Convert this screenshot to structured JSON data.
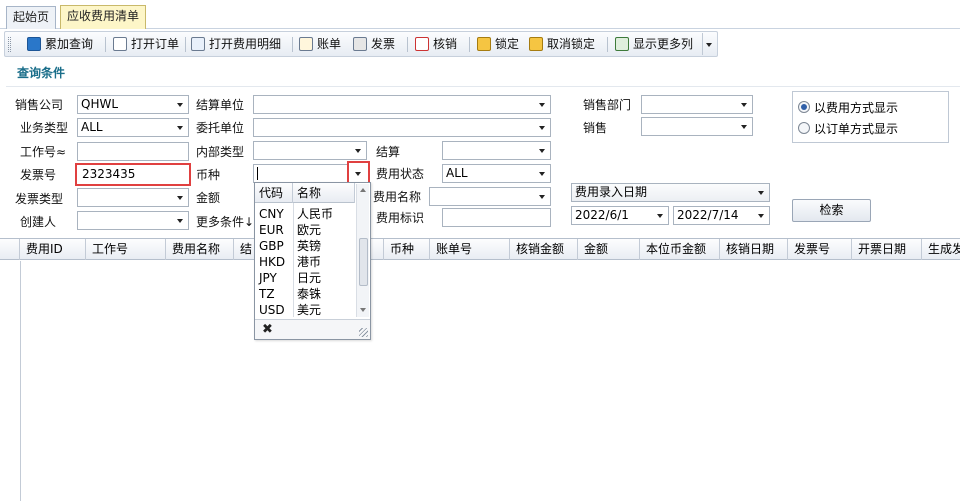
{
  "tabs": [
    {
      "label": "起始页",
      "active": false
    },
    {
      "label": "应收费用清单",
      "active": true
    }
  ],
  "toolbar": {
    "items": [
      {
        "label": "累加查询",
        "icon": "search-icon"
      },
      {
        "label": "打开订单",
        "icon": "document-icon"
      },
      {
        "label": "打开费用明细",
        "icon": "table-icon"
      },
      {
        "label": "账单",
        "icon": "bill-icon"
      },
      {
        "label": "发票",
        "icon": "invoice-icon"
      },
      {
        "label": "核销",
        "icon": "calendar-check-icon"
      },
      {
        "label": "锁定",
        "icon": "lock-icon"
      },
      {
        "label": "取消锁定",
        "icon": "unlock-icon"
      },
      {
        "label": "显示更多列",
        "icon": "columns-icon"
      }
    ]
  },
  "section_title": "查询条件",
  "form": {
    "sales_company": {
      "label": "销售公司",
      "value": "QHWL"
    },
    "business_type": {
      "label": "业务类型",
      "value": "ALL"
    },
    "job_no": {
      "label": "工作号≈",
      "value": ""
    },
    "invoice_no": {
      "label": "发票号",
      "value": "2323435"
    },
    "invoice_type": {
      "label": "发票类型",
      "value": ""
    },
    "creator": {
      "label": "创建人",
      "value": ""
    },
    "settle_unit": {
      "label": "结算单位",
      "value": ""
    },
    "consign_unit": {
      "label": "委托单位",
      "value": ""
    },
    "internal_type": {
      "label": "内部类型",
      "value": ""
    },
    "currency": {
      "label": "币种",
      "value": ""
    },
    "amount": {
      "label": "金额"
    },
    "more_conditions": {
      "label": "更多条件↓"
    },
    "settle": {
      "label": "结算",
      "value": ""
    },
    "fee_status": {
      "label": "费用状态",
      "value": "ALL"
    },
    "fee_name": {
      "label": "费用名称",
      "value": ""
    },
    "fee_mark": {
      "label": "费用标识",
      "value": ""
    },
    "sales_dept": {
      "label": "销售部门",
      "value": ""
    },
    "sales": {
      "label": "销售",
      "value": ""
    },
    "date_type": {
      "value": "费用录入日期"
    },
    "date_from": {
      "value": "2022/6/1"
    },
    "date_to": {
      "value": "2022/7/14"
    }
  },
  "display_mode": {
    "options": [
      {
        "label": "以费用方式显示",
        "selected": true
      },
      {
        "label": "以订单方式显示",
        "selected": false
      }
    ]
  },
  "search_button": "检索",
  "grid": {
    "columns": [
      "费用ID",
      "工作号",
      "费用名称",
      "结",
      "币种",
      "账单号",
      "核销金额",
      "金额",
      "本位币金额",
      "核销日期",
      "发票号",
      "开票日期",
      "生成发"
    ]
  },
  "currency_popup": {
    "headers": [
      "代码",
      "名称"
    ],
    "rows": [
      {
        "code": "CNY",
        "name": "人民币"
      },
      {
        "code": "EUR",
        "name": "欧元"
      },
      {
        "code": "GBP",
        "name": "英镑"
      },
      {
        "code": "HKD",
        "name": "港币"
      },
      {
        "code": "JPY",
        "name": "日元"
      },
      {
        "code": "TZ",
        "name": "泰铢"
      },
      {
        "code": "USD",
        "name": "美元"
      }
    ],
    "close_glyph": "✖"
  }
}
